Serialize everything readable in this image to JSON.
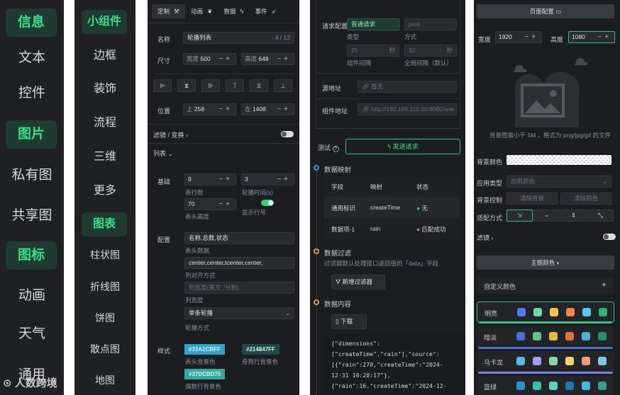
{
  "p1": {
    "items": [
      "信息",
      "文本",
      "控件",
      "图片",
      "私有图",
      "共享图",
      "图标",
      "动画",
      "天气",
      "通用"
    ],
    "watermark": "人数跨境"
  },
  "p2": {
    "items": [
      "小组件",
      "边框",
      "装饰",
      "流程",
      "三维",
      "更多",
      "图表",
      "柱状图",
      "折线图",
      "饼图",
      "散点图",
      "地图"
    ]
  },
  "p3": {
    "tabs": [
      "定制",
      "动画",
      "数据",
      "事件"
    ],
    "name_label": "名称",
    "name_value": "轮播列表",
    "name_count": "4 / 12",
    "size_label": "尺寸",
    "width_label": "宽度",
    "width_value": "500",
    "height_label": "高度",
    "height_value": "648",
    "pos_label": "位置",
    "top_label": "上",
    "top_value": "258",
    "left_label": "左",
    "left_value": "1408",
    "filter_label": "滤镜 / 变换",
    "list_label": "列表",
    "basic_label": "基础",
    "rows_value": "9",
    "rows_label": "表行数",
    "interval_value": "3",
    "interval_label": "轮播时间(s)",
    "head_h_value": "70",
    "head_h_label": "表头高度",
    "show_row_label": "显示行号",
    "config_label": "配置",
    "head_data_value": "名称,总数,状态",
    "head_data_label": "表头数据",
    "align_value": "center,center,tcenter,center,",
    "align_label": "列对齐方式",
    "colw_ph": "列宽度(英文','分割)",
    "colw_label": "列宽度",
    "mode_value": "单条轮播",
    "mode_label": "轮播方式",
    "style_label": "样式",
    "head_bg": "#33A2CBFF",
    "head_bg_label": "表头背景色",
    "odd_bg": "#214847FF",
    "odd_bg_label": "奇数行背景色",
    "even_bg": "#37DCBD75",
    "even_bg_label": "偶数行背景色"
  },
  "p4": {
    "req_label": "请求配置",
    "req_value": "普通请求",
    "method_ph": "post",
    "type_label": "类型",
    "mode_label": "方式",
    "comp_interval": "25",
    "sec": "秒",
    "global_interval": "30",
    "comp_interval_label": "组件间隔",
    "global_interval_label": "全局间隔（默认）",
    "src_label": "源地址",
    "src_ph": "暂无",
    "comp_url_label": "组件地址",
    "comp_url": "http://192.168.110.50:8080/war",
    "test_label": "测试",
    "send_label": "发送请求",
    "map_title": "数据映射",
    "col_field": "字段",
    "col_map": "映射",
    "col_status": "状态",
    "rows": [
      {
        "field": "通用标识",
        "map": "createTime",
        "status": "无"
      },
      {
        "field": "数据项-1",
        "map": "rain",
        "status": "匹配成功"
      }
    ],
    "filter_title": "数据过滤",
    "filter_desc": "过滤器默认处理接口返回值的「data」字段",
    "add_filter": "新增过滤器",
    "content_title": "数据内容",
    "download": "下载",
    "code": [
      "{\"dimensions\":",
      "[\"createTime\",\"rain\"],\"source\":",
      "[{\"rain\":270,\"createTime\":\"2024-",
      "12-31 10:28:17\"},",
      "{\"rain\":16,\"createTime\":\"2024-12-"
    ]
  },
  "p5": {
    "page_config": "页面配置",
    "width_label": "宽度",
    "width_value": "1920",
    "height_label": "高度",
    "height_value": "1080",
    "bg_hint": "背景图需小于 5M ，格式为 png/jpg/gif 的文件",
    "bg_color_label": "背景颜色",
    "app_type_label": "应用类型",
    "app_type_value": "应用颜色",
    "bg_ctrl_label": "背景控制",
    "clear_bg": "清除背景",
    "clear_color": "清除颜色",
    "fit_label": "适配方式",
    "filter_label": "滤镜",
    "theme_label": "主题颜色",
    "custom_color": "自定义颜色",
    "themes": [
      {
        "name": "明亮",
        "colors": [
          "#4f7cf0",
          "#6fd6a8",
          "#f5c542",
          "#f08a4b",
          "#5bc8f0",
          "#2fb37a"
        ],
        "bar": "#39c08a"
      },
      {
        "name": "暗淡",
        "colors": [
          "#4a6fd1",
          "#6ac08f",
          "#e8b940",
          "#e0743f",
          "#4bb2d9",
          "#1f9466"
        ],
        "bar": "#4a6fd1"
      },
      {
        "name": "马卡龙",
        "colors": [
          "#5bb7e8",
          "#a39df0",
          "#8ad5b0",
          "#f5d270",
          "#f09c7a",
          "#7ec8e3"
        ],
        "bar": "#7d7ff0"
      },
      {
        "name": "蓝绿",
        "colors": [
          "#2f8fc8",
          "#39c0a8",
          "#5bd1c0",
          "#1f7ab0",
          "#47b8e0",
          "#2fa08a"
        ],
        "bar": "#2fa08a"
      }
    ]
  }
}
